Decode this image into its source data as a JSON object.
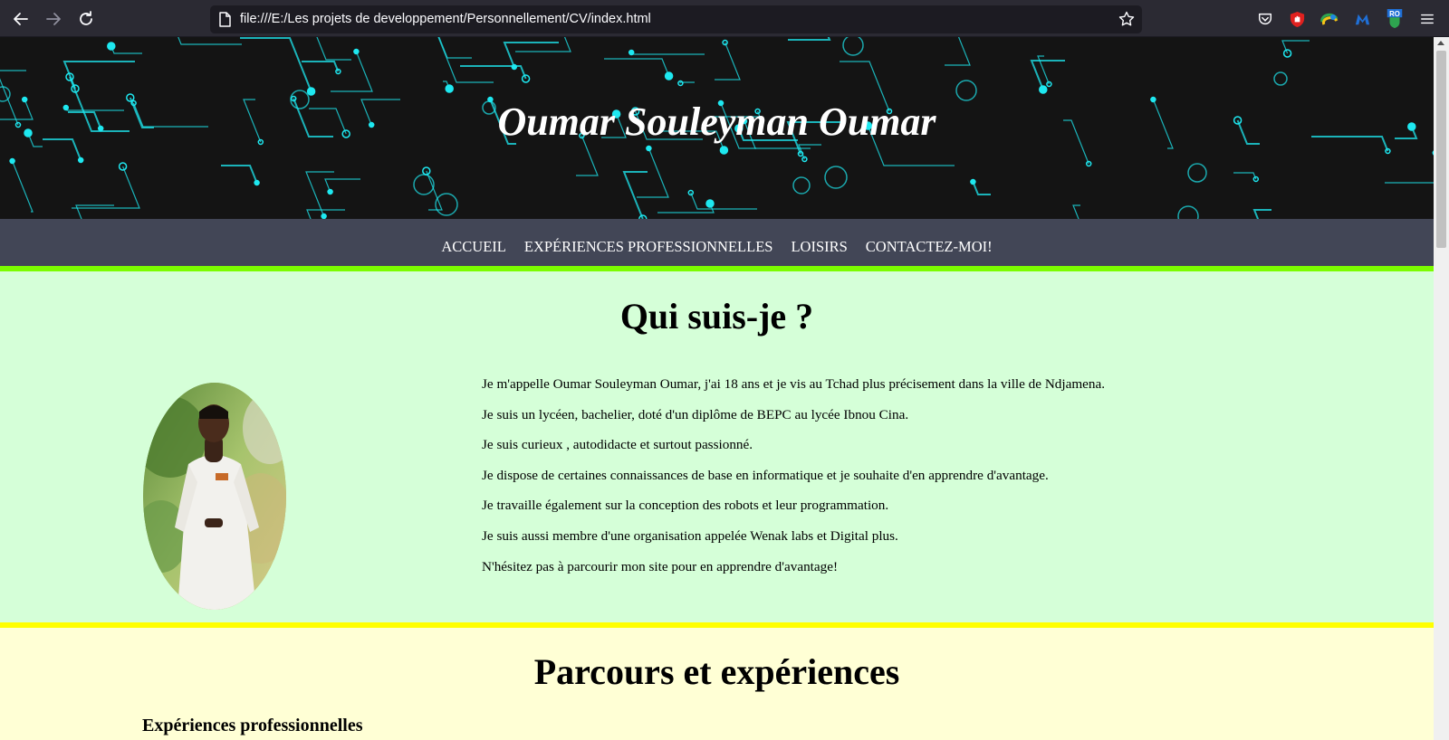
{
  "browser": {
    "url": "file:///E:/Les projets de developpement/Personnellement/CV/index.html",
    "extensions": [
      "pocket-icon",
      "ublock-icon",
      "extension-globe-icon",
      "malwarebytes-icon",
      "ro-badge-icon"
    ],
    "ro_badge": "RO"
  },
  "header": {
    "title": "Oumar Souleyman Oumar"
  },
  "nav": {
    "items": [
      "ACCUEIL",
      "EXPÉRIENCES PROFESSIONNELLES",
      "LOISIRS",
      "CONTACTEZ-MOI!"
    ]
  },
  "about": {
    "title": "Qui suis-je ?",
    "paragraphs": [
      "Je m'appelle Oumar Souleyman Oumar, j'ai 18 ans et je vis au Tchad plus précisement dans la ville de Ndjamena.",
      "Je suis un lycéen, bachelier, doté d'un diplôme de BEPC au lycée Ibnou Cina.",
      "Je suis curieux , autodidacte et surtout passionné.",
      "Je dispose de certaines connaissances de base en informatique et je souhaite d'en apprendre d'avantage.",
      "Je travaille également sur la conception des robots et leur programmation.",
      "Je suis aussi membre d'une organisation appelée Wenak labs et Digital plus.",
      "N'hésitez pas à parcourir mon site pour en apprendre d'avantage!"
    ]
  },
  "parcours": {
    "title": "Parcours et expériences",
    "subtitle": "Expériences professionnelles"
  },
  "colors": {
    "nav_bg": "#424656",
    "nav_border": "#7cfc00",
    "about_bg": "#d5ffd8",
    "divider": "#ffff00",
    "parcours_bg": "#ffffd5",
    "circuit": "#1ee8f0"
  }
}
